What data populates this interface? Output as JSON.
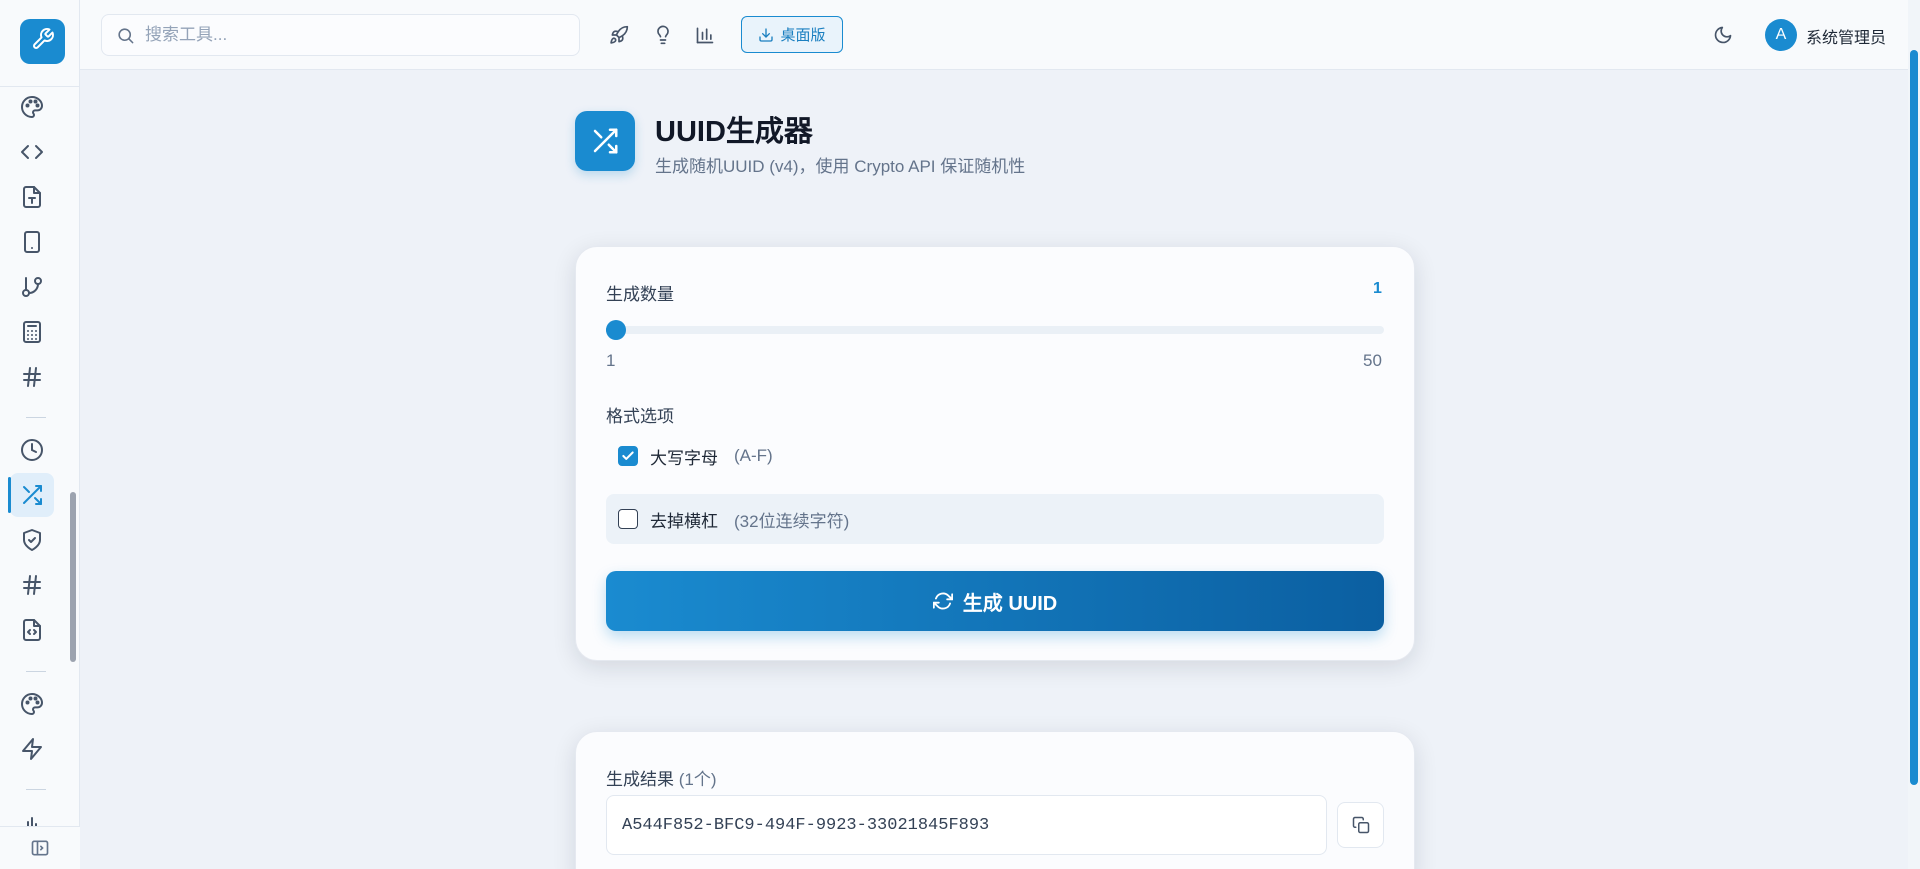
{
  "topbar": {
    "search_placeholder": "搜索工具...",
    "desktop_label": "桌面版",
    "avatar_initial": "A",
    "username": "系统管理员"
  },
  "sidebar": {
    "icons": [
      "palette-icon",
      "code-icon",
      "file-text-icon",
      "tablet-icon",
      "git-branch-icon",
      "calculator-icon",
      "hash-icon",
      "clock-icon",
      "shuffle-icon",
      "shield-check-icon",
      "hash-icon",
      "file-code-icon",
      "palette-icon",
      "zap-icon",
      "chart-icon"
    ],
    "active": "shuffle-icon"
  },
  "tool": {
    "title": "UUID生成器",
    "subtitle": "生成随机UUID (v4)，使用 Crypto API 保证随机性"
  },
  "generator": {
    "count_label": "生成数量",
    "count_value": "1",
    "slider": {
      "value": 1,
      "min": 1,
      "max": 50,
      "min_label": "1",
      "max_label": "50"
    },
    "format_label": "格式选项",
    "options": [
      {
        "name": "大写字母",
        "hint": "(A-F)",
        "checked": true
      },
      {
        "name": "去掉横杠",
        "hint": "(32位连续字符)",
        "checked": false
      }
    ],
    "button_label": "生成 UUID"
  },
  "result": {
    "label": "生成结果",
    "count": "(1个)",
    "uuids": [
      "A544F852-BFC9-494F-9923-33021845F893"
    ]
  },
  "colors": {
    "accent": "#1a8bd0",
    "accent_dark": "#0b5fa1"
  }
}
